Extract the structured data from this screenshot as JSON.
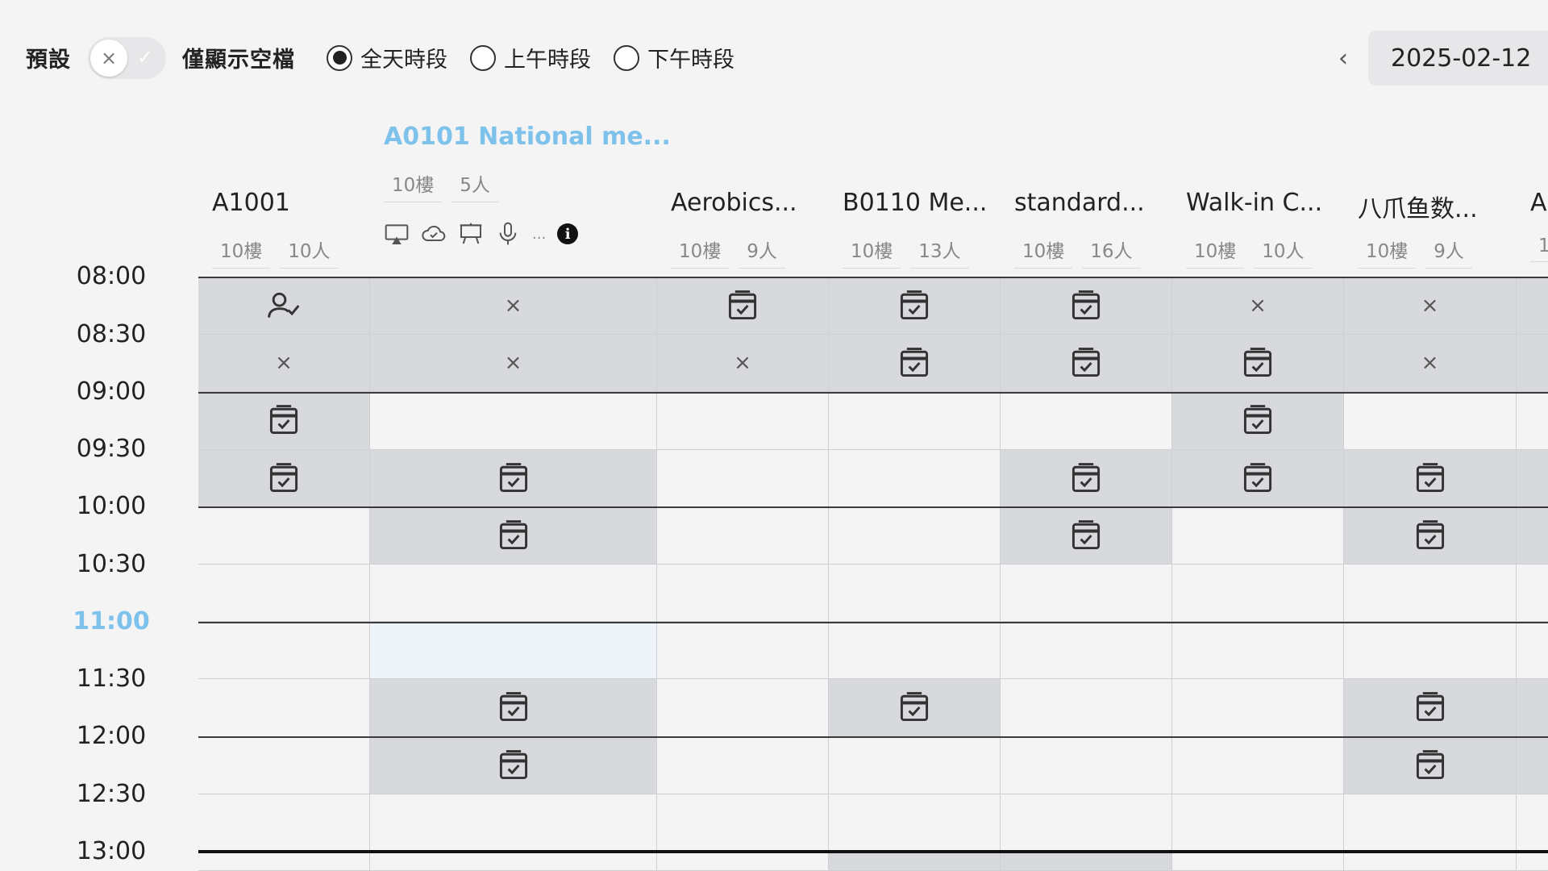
{
  "toolbar": {
    "default_label": "預設",
    "only_free_label": "僅顯示空檔",
    "toggle_off_icon": "×",
    "toggle_on_icon": "✓",
    "radio_all": "全天時段",
    "radio_am": "上午時段",
    "radio_pm": "下午時段",
    "selected": "all",
    "prev_icon": "‹",
    "date": "2025-02-12"
  },
  "rooms": [
    {
      "name": "A1001",
      "floor": "10樓",
      "capacity": "10人"
    },
    {
      "name": "A0101 National me...",
      "floor": "10樓",
      "capacity": "5人",
      "amenities": [
        "tv-icon",
        "cloud-icon",
        "projector-board-icon",
        "microphone-icon"
      ],
      "more": "...",
      "info": "i"
    },
    {
      "name": "Aerobics...",
      "floor": "10樓",
      "capacity": "9人"
    },
    {
      "name": "B0110 Me...",
      "floor": "10樓",
      "capacity": "13人"
    },
    {
      "name": "standard...",
      "floor": "10樓",
      "capacity": "16人"
    },
    {
      "name": "Walk-in C...",
      "floor": "10樓",
      "capacity": "10人"
    },
    {
      "name": "八爪鱼数...",
      "floor": "10樓",
      "capacity": "9人"
    },
    {
      "name": "A",
      "floor": "1",
      "capacity": ""
    }
  ],
  "times": [
    "08:00",
    "08:30",
    "09:00",
    "09:30",
    "10:00",
    "10:30",
    "11:00",
    "11:30",
    "12:00",
    "12:30",
    "13:00"
  ],
  "current_time": "11:00",
  "grid": [
    [
      "user-check",
      "x",
      "cal",
      "cal",
      "cal",
      "x",
      "x",
      "b"
    ],
    [
      "x",
      "x",
      "x",
      "cal",
      "cal",
      "cal",
      "x",
      "b"
    ],
    [
      "cal",
      "e",
      "e",
      "e",
      "e",
      "cal",
      "e",
      "e"
    ],
    [
      "cal",
      "cal",
      "e",
      "e",
      "cal",
      "cal",
      "cal",
      "b"
    ],
    [
      "e",
      "cal",
      "e",
      "e",
      "cal",
      "e",
      "cal",
      "b"
    ],
    [
      "e",
      "e",
      "e",
      "e",
      "e",
      "e",
      "e",
      "e"
    ],
    [
      "e",
      "hl",
      "e",
      "e",
      "e",
      "e",
      "e",
      "e"
    ],
    [
      "e",
      "cal",
      "e",
      "cal",
      "e",
      "e",
      "cal",
      "b"
    ],
    [
      "e",
      "cal",
      "e",
      "e",
      "e",
      "e",
      "cal",
      "b"
    ],
    [
      "e",
      "e",
      "e",
      "e",
      "e",
      "e",
      "e",
      "e"
    ],
    [
      "e",
      "e",
      "e",
      "cal",
      "cal",
      "e",
      "e",
      "e"
    ]
  ]
}
